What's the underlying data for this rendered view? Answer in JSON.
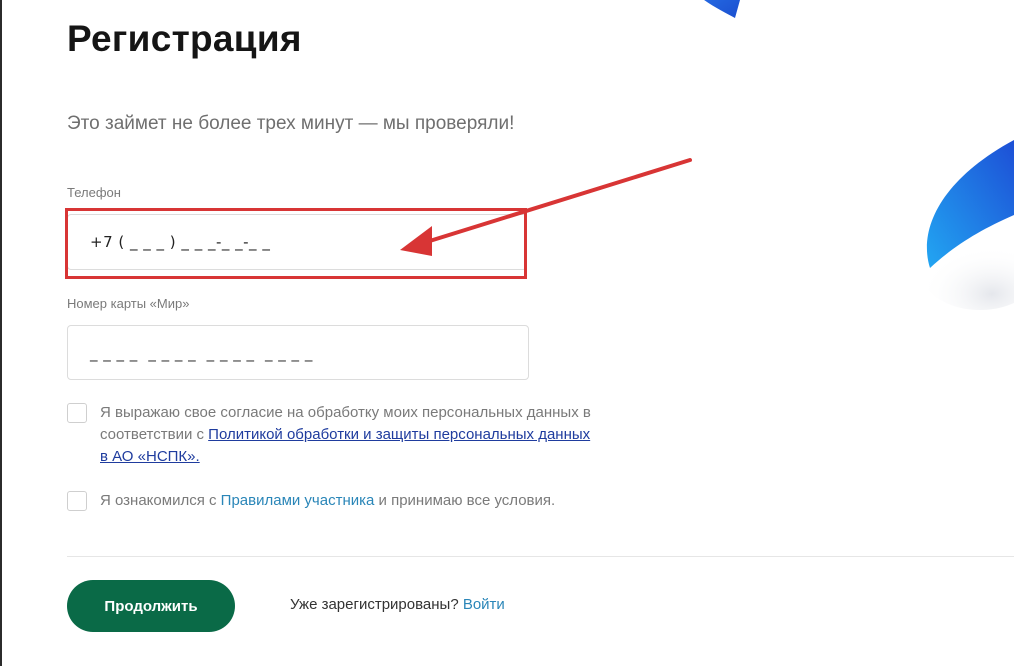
{
  "header": {
    "title": "Регистрация",
    "subtitle": "Это займет не более трех минут — мы проверяли!"
  },
  "phone": {
    "label": "Телефон",
    "value": "+7 ( _ _ _ ) _ _ _-_ _-_ _"
  },
  "card": {
    "label": "Номер карты «Мир»",
    "value": "_ _ _ _  _ _ _ _  _ _ _ _  _ _ _ _"
  },
  "consent": {
    "text_prefix": "Я выражаю свое согласие на обработку моих персональных данных в соответствии с ",
    "link": "Политикой обработки и защиты персональных данных в АО «НСПК».",
    "checked": false
  },
  "rules": {
    "text_prefix": "Я ознакомился с ",
    "link": "Правилами участника",
    "text_suffix": " и принимаю все условия.",
    "checked": false
  },
  "actions": {
    "continue_label": "Продолжить",
    "already_text": "Уже зарегистрированы? ",
    "login_label": "Войти"
  },
  "colors": {
    "primary_button": "#0a6a47",
    "annotation_red": "#d83535",
    "link_blue": "#2a86b8",
    "link_dark_blue": "#1f3c9e",
    "decor_blue": "#1e6fe0"
  },
  "icons": {
    "annotation_arrow": "arrow-icon"
  }
}
